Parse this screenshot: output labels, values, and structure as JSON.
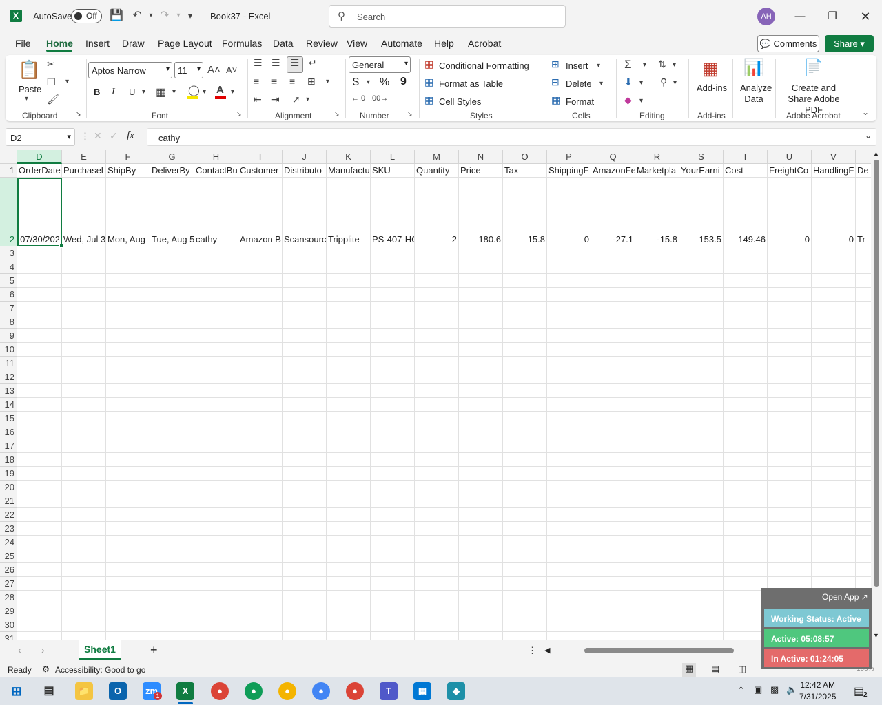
{
  "titlebar": {
    "autosave_label": "AutoSave",
    "autosave_state": "Off",
    "doc_title": "Book37 - Excel",
    "search_placeholder": "Search",
    "avatar_initials": "AH"
  },
  "tabs": [
    "File",
    "Home",
    "Insert",
    "Draw",
    "Page Layout",
    "Formulas",
    "Data",
    "Review",
    "View",
    "Automate",
    "Help",
    "Acrobat"
  ],
  "active_tab": "Home",
  "comments_label": "Comments",
  "share_label": "Share",
  "ribbon": {
    "clipboard": {
      "label": "Clipboard",
      "paste": "Paste"
    },
    "font": {
      "label": "Font",
      "name": "Aptos Narrow",
      "size": "11",
      "bold": "B",
      "italic": "I",
      "underline": "U"
    },
    "alignment": {
      "label": "Alignment"
    },
    "number": {
      "label": "Number",
      "format": "General",
      "currency": "$",
      "percent": "%",
      "comma": "9"
    },
    "styles": {
      "label": "Styles",
      "conditional": "Conditional Formatting",
      "format_table": "Format as Table",
      "cell_styles": "Cell Styles"
    },
    "cells": {
      "label": "Cells",
      "insert": "Insert",
      "delete": "Delete",
      "format": "Format"
    },
    "editing": {
      "label": "Editing"
    },
    "addins": {
      "label": "Add-ins",
      "button": "Add-ins"
    },
    "analyze": {
      "button": "Analyze Data"
    },
    "acrobat": {
      "label": "Adobe Acrobat",
      "button": "Create and Share Adobe PDF"
    }
  },
  "formula_bar": {
    "name_box": "D2",
    "fx": "fx",
    "content": "cathy"
  },
  "columns": [
    {
      "letter": "D",
      "header": "OrderDate",
      "value": "07/30/202",
      "num": true
    },
    {
      "letter": "E",
      "header": "Purchasel",
      "value": "Wed, Jul 3",
      "num": false
    },
    {
      "letter": "F",
      "header": "ShipBy",
      "value": "Mon, Aug",
      "num": false
    },
    {
      "letter": "G",
      "header": "DeliverBy",
      "value": "Tue, Aug 5",
      "num": false
    },
    {
      "letter": "H",
      "header": "ContactBu",
      "value": "cathy",
      "num": false
    },
    {
      "letter": "I",
      "header": "Customer",
      "value": "Amazon B",
      "num": false
    },
    {
      "letter": "J",
      "header": "Distributo",
      "value": "Scansourc",
      "num": false
    },
    {
      "letter": "K",
      "header": "Manufactu",
      "value": "Tripplite",
      "num": false
    },
    {
      "letter": "L",
      "header": "SKU",
      "value": "PS-407-HG",
      "num": false
    },
    {
      "letter": "M",
      "header": "Quantity",
      "value": "2",
      "num": true
    },
    {
      "letter": "N",
      "header": "Price",
      "value": "180.6",
      "num": true
    },
    {
      "letter": "O",
      "header": "Tax",
      "value": "15.8",
      "num": true
    },
    {
      "letter": "P",
      "header": "ShippingF",
      "value": "0",
      "num": true
    },
    {
      "letter": "Q",
      "header": "AmazonFe",
      "value": "-27.1",
      "num": true
    },
    {
      "letter": "R",
      "header": "Marketpla",
      "value": "-15.8",
      "num": true
    },
    {
      "letter": "S",
      "header": "YourEarni",
      "value": "153.5",
      "num": true
    },
    {
      "letter": "T",
      "header": "Cost",
      "value": "149.46",
      "num": true
    },
    {
      "letter": "U",
      "header": "FreightCo",
      "value": "0",
      "num": true
    },
    {
      "letter": "V",
      "header": "HandlingF",
      "value": "0",
      "num": true
    },
    {
      "letter": "W",
      "header": "De",
      "value": "Tr",
      "num": false
    }
  ],
  "row_numbers": [
    "1",
    "2",
    "3",
    "4",
    "5",
    "6",
    "7",
    "8",
    "9",
    "10",
    "11",
    "12",
    "13",
    "14",
    "15",
    "16",
    "17",
    "18",
    "19",
    "20",
    "21",
    "22",
    "23",
    "24",
    "25",
    "26",
    "27",
    "28",
    "29",
    "30",
    "31"
  ],
  "sheet": {
    "name": "Sheet1",
    "add": "+"
  },
  "status": {
    "ready": "Ready",
    "accessibility": "Accessibility: Good to go",
    "zoom": "100%"
  },
  "widget": {
    "open_app": "Open App ↗",
    "working": "Working Status: Active",
    "active": "Active: 05:08:57",
    "inactive": "In Active: 01:24:05",
    "colors": {
      "working": "#7ec8d3",
      "active": "#4fc77e",
      "inactive": "#e46a6a"
    }
  },
  "taskbar": {
    "time": "12:42 AM",
    "date": "7/31/2025",
    "notif_count": "2",
    "zoom_badge": "1"
  }
}
